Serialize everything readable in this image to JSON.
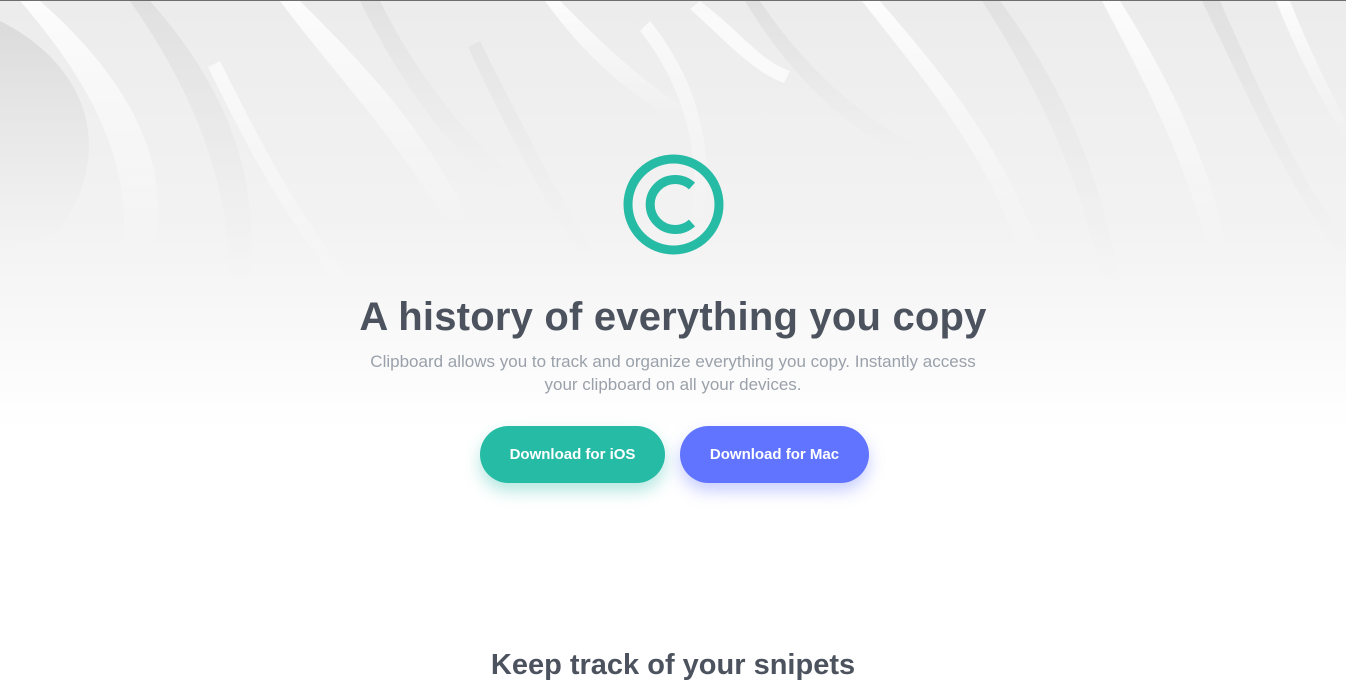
{
  "colors": {
    "accent_teal": "#26bba5",
    "accent_blue": "#6174ff",
    "heading": "#4c535e",
    "body_text": "#9aa1aa"
  },
  "hero": {
    "logo_icon": "copyright-icon",
    "headline": "A history of everything you copy",
    "subtitle": "Clipboard allows you to track and organize everything you copy. Instantly access your clipboard on all your devices.",
    "buttons": {
      "ios_label": "Download for iOS",
      "mac_label": "Download for Mac"
    }
  },
  "snippets": {
    "title": "Keep track of your snipets"
  }
}
